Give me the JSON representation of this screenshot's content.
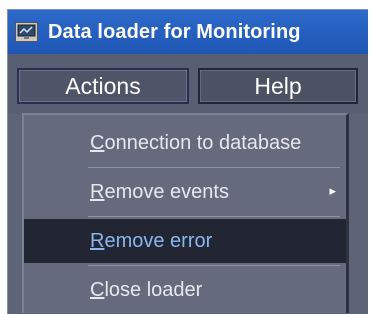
{
  "window": {
    "title": "Data loader for Monitoring",
    "icon": "monitor-app-icon"
  },
  "menubar": {
    "items": [
      {
        "label": "Actions",
        "state": "open"
      },
      {
        "label": "Help"
      }
    ]
  },
  "dropdown": {
    "items": [
      {
        "mnemonic": "C",
        "rest": "onnection to database",
        "submenu": false,
        "highlighted": false
      },
      {
        "mnemonic": "R",
        "rest": "emove events",
        "submenu": true,
        "submenu_icon": "▸",
        "highlighted": false
      },
      {
        "mnemonic": "R",
        "rest": "emove error",
        "submenu": false,
        "highlighted": true
      },
      {
        "mnemonic": "C",
        "rest": "lose loader",
        "submenu": false,
        "highlighted": false
      }
    ]
  },
  "colors": {
    "title_bar": "#1f56b6",
    "menu_background": "#595f73",
    "dropdown_background": "#656a7c",
    "highlight_background": "#222532",
    "highlight_text": "#8ab6ef"
  }
}
